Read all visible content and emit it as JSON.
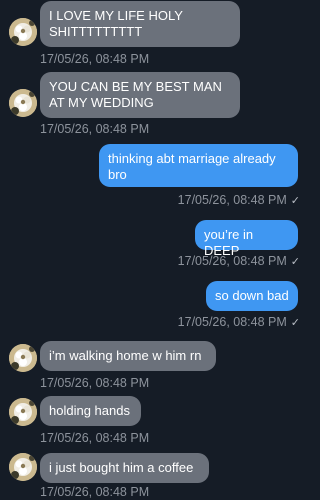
{
  "messages": [
    {
      "direction": "incoming",
      "text": "I LOVE MY LIFE HOLY SHITTTTTTTTT",
      "timestamp": "17/05/26, 08:48 PM"
    },
    {
      "direction": "incoming",
      "text": "YOU CAN BE MY BEST MAN AT MY WEDDING",
      "timestamp": "17/05/26, 08:48 PM"
    },
    {
      "direction": "outgoing",
      "text": "thinking abt marriage already bro",
      "timestamp": "17/05/26, 08:48 PM",
      "status": "✓"
    },
    {
      "direction": "outgoing",
      "text": "you’re in DEEP",
      "timestamp": "17/05/26, 08:48 PM",
      "status": "✓"
    },
    {
      "direction": "outgoing",
      "text": "so down bad",
      "timestamp": "17/05/26, 08:48 PM",
      "status": "✓"
    },
    {
      "direction": "incoming",
      "text": "i’m walking home w him rn",
      "timestamp": "17/05/26, 08:48 PM"
    },
    {
      "direction": "incoming",
      "text": "holding hands",
      "timestamp": "17/05/26, 08:48 PM"
    },
    {
      "direction": "incoming",
      "text": "i just bought him a coffee",
      "timestamp": "17/05/26, 08:48 PM"
    }
  ],
  "colors": {
    "background": "#151c26",
    "incoming_bubble": "#6b717b",
    "outgoing_bubble": "#3f97f2",
    "timestamp": "#8d939c"
  },
  "icons": {
    "avatar": "flower-avatar-icon",
    "read_status": "checkmark-icon"
  }
}
